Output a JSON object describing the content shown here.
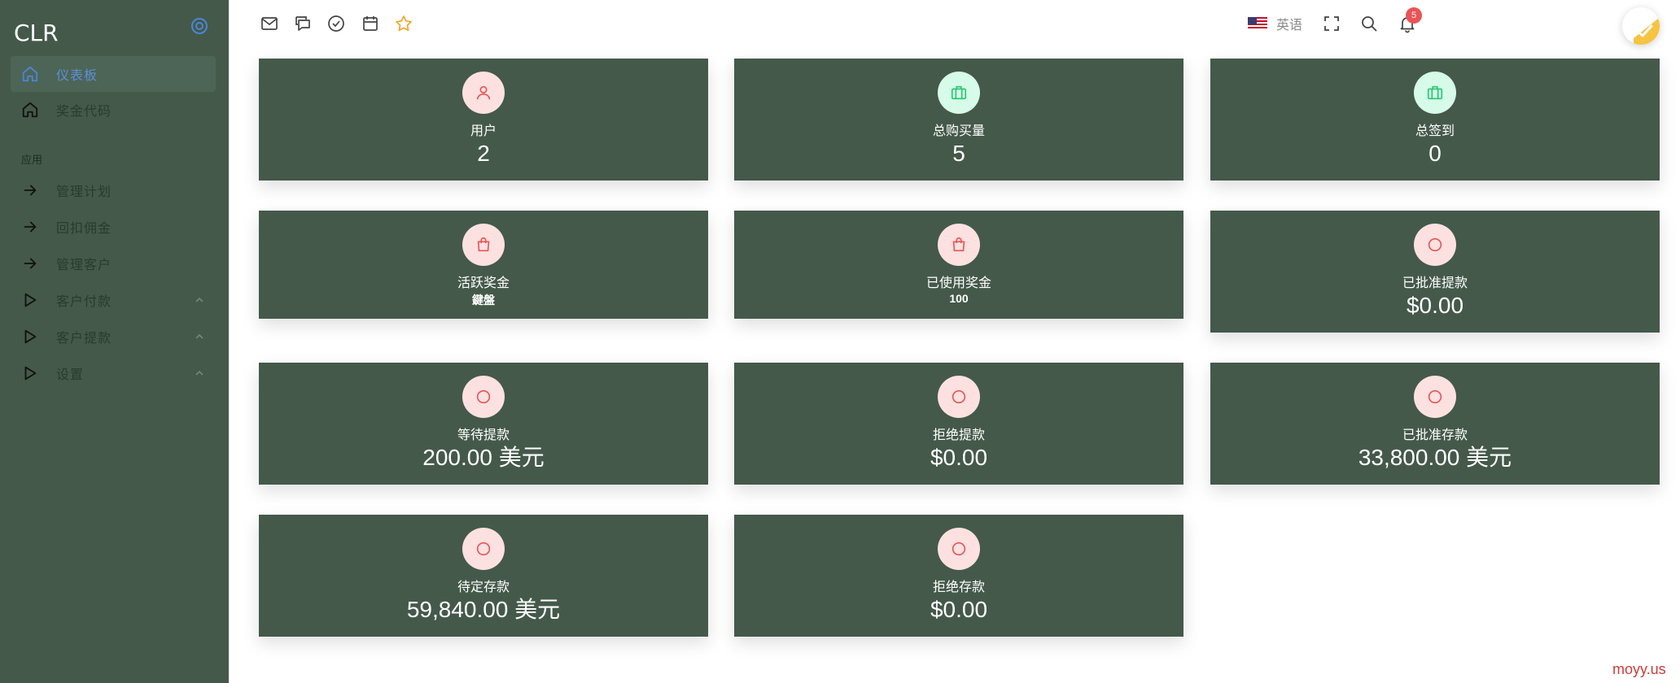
{
  "sidebar": {
    "brand": "CLR",
    "section_label": "应用",
    "items": [
      {
        "label": "仪表板"
      },
      {
        "label": "奖金代码"
      },
      {
        "label": "管理计划"
      },
      {
        "label": "回扣佣金"
      },
      {
        "label": "管理客户"
      },
      {
        "label": "客户付款"
      },
      {
        "label": "客户提款"
      },
      {
        "label": "设置"
      }
    ]
  },
  "topbar": {
    "language": "英语",
    "notification_count": "5"
  },
  "cards": [
    {
      "label": "用户",
      "value": "2"
    },
    {
      "label": "总购买量",
      "value": "5"
    },
    {
      "label": "总签到",
      "value": "0"
    },
    {
      "label": "活跃奖金",
      "value": "鍵盤"
    },
    {
      "label": "已使用奖金",
      "value": "100"
    },
    {
      "label": "已批准提款",
      "value": "$0.00"
    },
    {
      "label": "等待提款",
      "value": "200.00 美元"
    },
    {
      "label": "拒绝提款",
      "value": "$0.00"
    },
    {
      "label": "已批准存款",
      "value": "33,800.00 美元"
    },
    {
      "label": "待定存款",
      "value": "59,840.00 美元"
    },
    {
      "label": "拒绝存款",
      "value": "$0.00"
    }
  ],
  "icons": {
    "user": "user-icon",
    "briefcase": "briefcase-icon",
    "shopping_bag": "shopping-bag-icon",
    "circle": "circle-icon"
  },
  "colors": {
    "sidebar_bg": "#44594a",
    "card_bg": "#44594a",
    "accent_blue": "#5b8fd8",
    "pink_icon": "#ea5455",
    "mint_icon": "#28c76f",
    "badge": "#ea5455"
  },
  "watermark": "moyy.us"
}
